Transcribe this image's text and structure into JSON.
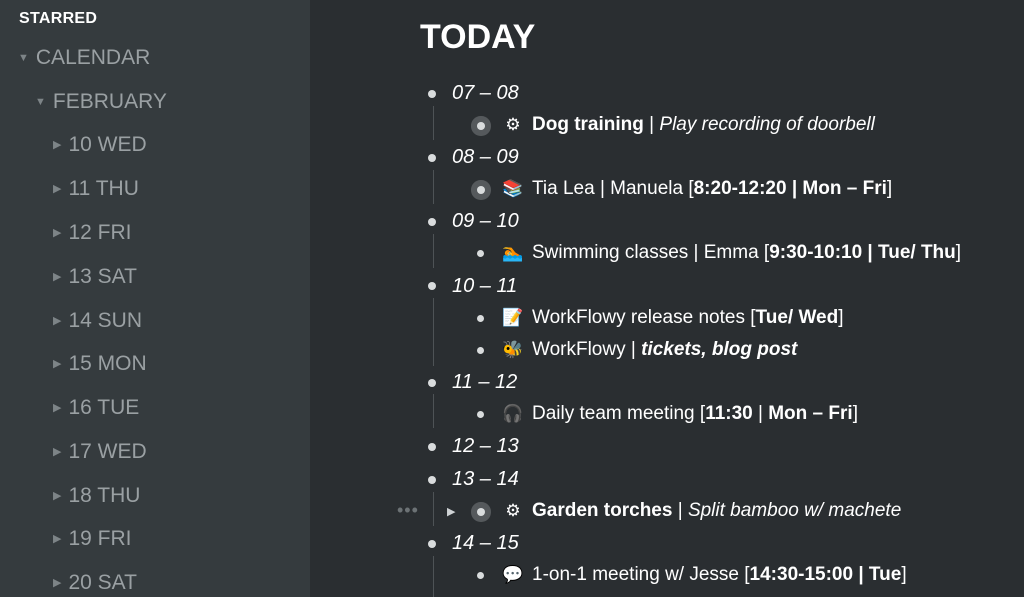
{
  "sidebar": {
    "header": "STARRED",
    "calendar": "CALENDAR",
    "month": "FEBRUARY",
    "days": [
      "10 WED",
      "11 THU",
      "12 FRI",
      "13 SAT",
      "14 SUN",
      "15 MON",
      "16 TUE",
      "17 WED",
      "18 THU",
      "19 FRI",
      "20 SAT"
    ]
  },
  "main": {
    "title": "TODAY",
    "hours": [
      "07 – 08",
      "08 – 09",
      "09 – 10",
      "10 – 11",
      "11 – 12",
      "12 – 13",
      "13 – 14",
      "14 – 15"
    ],
    "tasks": {
      "dog": {
        "name": "Dog training",
        "sep": " | ",
        "note": "Play recording of doorbell"
      },
      "tia": {
        "a": "Tia Lea | Manuela [",
        "b": "8:20-12:20 | Mon – Fri",
        "c": "]"
      },
      "swim": {
        "a": "Swimming classes | Emma [",
        "b": "9:30-10:10 | Tue/ Thu",
        "c": "]"
      },
      "notes": {
        "a": "WorkFlowy release notes [",
        "b": "Tue/ Wed",
        "c": "]"
      },
      "wf": {
        "a": "WorkFlowy | ",
        "b": "tickets, blog post"
      },
      "team": {
        "a": "Daily team meeting [",
        "b": "11:30",
        "c": " | ",
        "d": "Mon – Fri",
        "e": "]"
      },
      "garden": {
        "name": "Garden torches",
        "sep": " | ",
        "note": "Split bamboo w/ machete"
      },
      "oneone": {
        "a": "1-on-1 meeting w/ Jesse  [",
        "b": "14:30-15:00 | Tue",
        "c": "]"
      }
    },
    "ellipsis": "•••"
  }
}
